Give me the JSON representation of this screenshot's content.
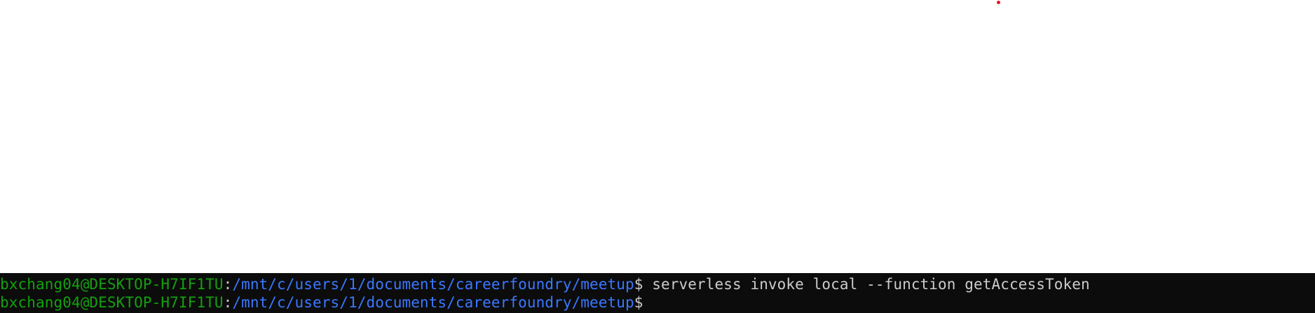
{
  "terminal": {
    "colors": {
      "background": "#0c0c0c",
      "user": "#13a10e",
      "path": "#3b78ff",
      "text": "#cccccc"
    },
    "lines": [
      {
        "user": "bxchang04@DESKTOP-H7IF1TU",
        "sep": ":",
        "path": "/mnt/c/users/1/documents/careerfoundry/meetup",
        "prompt": "$",
        "command": " serverless invoke local --function getAccessToken"
      },
      {
        "user": "bxchang04@DESKTOP-H7IF1TU",
        "sep": ":",
        "path": "/mnt/c/users/1/documents/careerfoundry/meetup",
        "prompt": "$",
        "command": ""
      }
    ]
  }
}
